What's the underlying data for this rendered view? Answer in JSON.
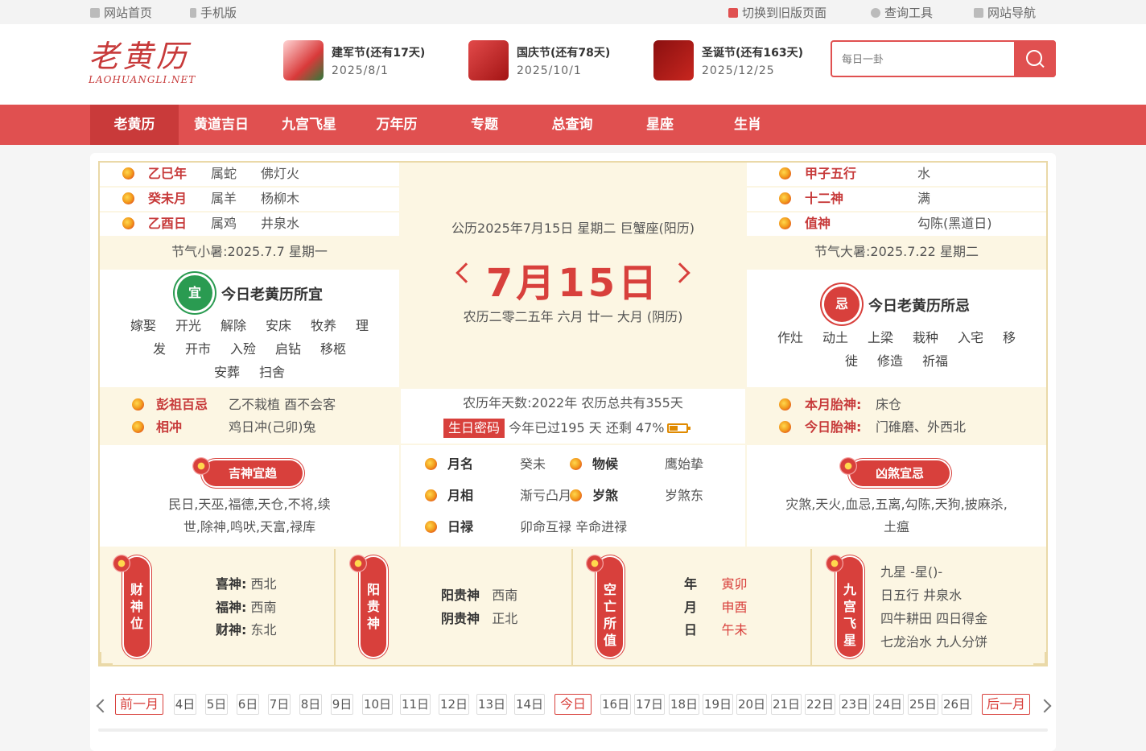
{
  "topbar": {
    "home": "网站首页",
    "mobile": "手机版",
    "old": "切换到旧版页面",
    "tools": "查询工具",
    "nav": "网站导航"
  },
  "logo": {
    "cn": "老黄历",
    "en": "LAOHUANGLI.NET"
  },
  "festivals": [
    {
      "name": "建军节(还有17天)",
      "date": "2025/8/1"
    },
    {
      "name": "国庆节(还有78天)",
      "date": "2025/10/1"
    },
    {
      "name": "圣诞节(还有163天)",
      "date": "2025/12/25"
    }
  ],
  "search": {
    "placeholder": "每日一卦"
  },
  "nav": [
    "老黄历",
    "黄道吉日",
    "九宫飞星",
    "万年历",
    "专题",
    "总查询",
    "星座",
    "生肖"
  ],
  "left_top": [
    {
      "gz": "乙巳年",
      "sx": "属蛇",
      "wx": "佛灯火"
    },
    {
      "gz": "癸未月",
      "sx": "属羊",
      "wx": "杨柳木"
    },
    {
      "gz": "乙酉日",
      "sx": "属鸡",
      "wx": "井泉水"
    }
  ],
  "jieqi_left": "节气小暑:2025.7.7 星期一",
  "jieqi_right": "节气大暑:2025.7.22 星期二",
  "right_top": [
    {
      "k": "甲子五行",
      "v": "水"
    },
    {
      "k": "十二神",
      "v": "满"
    },
    {
      "k": "值神",
      "v": "勾陈(黑道日)"
    }
  ],
  "yi": {
    "badge": "宜",
    "title": "今日老黄历所宜",
    "line1": [
      "嫁娶",
      "开光",
      "解除",
      "安床",
      "牧养",
      "理"
    ],
    "line2": [
      "发",
      "开市",
      "入殓",
      "启钻",
      "移柩"
    ],
    "line3": [
      "安葬",
      "扫舍"
    ]
  },
  "ji": {
    "badge": "忌",
    "title": "今日老黄历所忌",
    "line1": [
      "作灶",
      "动土",
      "上梁",
      "栽种",
      "入宅",
      "移"
    ],
    "line2": [
      "徙",
      "修造",
      "祈福"
    ]
  },
  "date": {
    "top": "公历2025年7月15日 星期二 巨蟹座(阳历)",
    "big": "7月15日",
    "lunar": "农历二零二五年 六月 廿一 大月 (阴历)"
  },
  "pengzu": {
    "k1": "彭祖百忌",
    "v1": "乙不栽植 酉不会客",
    "k2": "相冲",
    "v2": "鸡日冲(己卯)兔"
  },
  "yearinfo": {
    "line1": "农历年天数:2022年 农历总共有355天",
    "badge": "生日密码",
    "line2": "今年已过195 天 还剩 47%"
  },
  "taishen": {
    "k1": "本月胎神:",
    "v1": "床仓",
    "k2": "今日胎神:",
    "v2": "门碓磨、外西北"
  },
  "jishen": {
    "title": "吉神宜趋",
    "text1": "民日,天巫,福德,天仓,不将,续",
    "text2": "世,除神,鸣吠,天富,禄库"
  },
  "xiongsha": {
    "title": "凶煞宜忌",
    "text1": "灾煞,天火,血忌,五离,勾陈,天狗,披麻杀,",
    "text2": "土瘟"
  },
  "mid_mid": [
    {
      "k": "月名",
      "v": "癸未"
    },
    {
      "k": "物候",
      "v": "鹰始挚"
    },
    {
      "k": "月相",
      "v": "渐亏凸月"
    },
    {
      "k": "岁煞",
      "v": "岁煞东"
    },
    {
      "k": "日禄",
      "v": "卯命互禄 辛命进禄"
    }
  ],
  "caishen": {
    "title": "财神位",
    "xi_k": "喜神:",
    "xi_v": "西北",
    "fu_k": "福神:",
    "fu_v": "西南",
    "cai_k": "财神:",
    "cai_v": "东北"
  },
  "guishen": {
    "title": "阳贵神",
    "yang_k": "阳贵神",
    "yang_v": "西南",
    "yin_k": "阴贵神",
    "yin_v": "正北"
  },
  "kongwang": {
    "title": "空亡所值",
    "y_k": "年",
    "y_v": "寅卯",
    "m_k": "月",
    "m_v": "申酉",
    "d_k": "日",
    "d_v": "午未"
  },
  "jiugong": {
    "title": "九宫飞星",
    "l1": "九星 -星()-",
    "l2": "日五行 井泉水",
    "l3": "四牛耕田 四日得金",
    "l4": "七龙治水 九人分饼"
  },
  "days": {
    "prev": "前一月",
    "next": "后一月",
    "today": "今日",
    "list": [
      "4日",
      "5日",
      "6日",
      "7日",
      "8日",
      "9日",
      "10日",
      "11日",
      "12日",
      "13日",
      "14日",
      "16日",
      "17日",
      "18日",
      "19日",
      "20日",
      "21日",
      "22日",
      "23日",
      "24日",
      "25日",
      "26日"
    ]
  }
}
